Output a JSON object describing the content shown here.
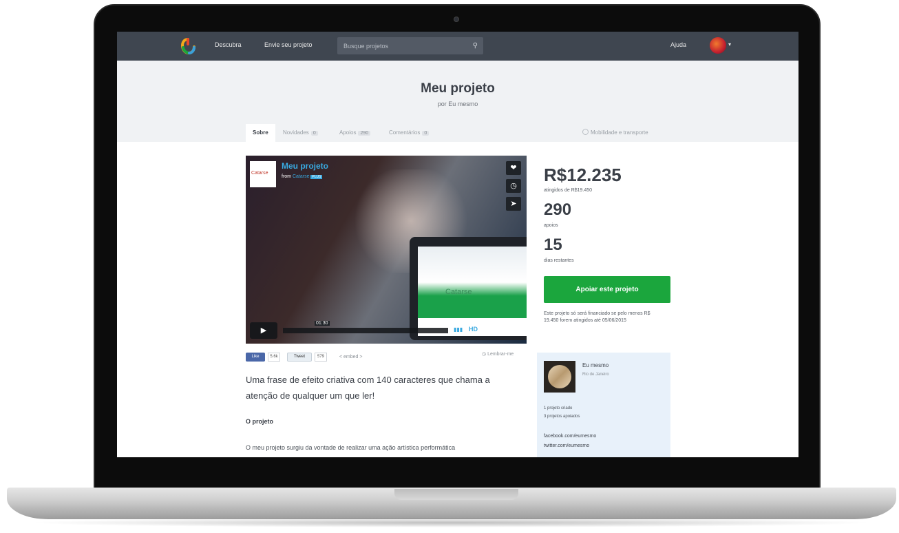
{
  "topbar": {
    "nav": [
      "Descubra",
      "Envie seu projeto"
    ],
    "search_placeholder": "Busque projetos",
    "help": "Ajuda"
  },
  "project": {
    "title": "Meu projeto",
    "byline": "por Eu mesmo",
    "category": "Mobilidade e transporte"
  },
  "tabs": [
    {
      "label": "Sobre",
      "count": ""
    },
    {
      "label": "Novidades",
      "count": "0"
    },
    {
      "label": "Apoios",
      "count": "290"
    },
    {
      "label": "Comentários",
      "count": "0"
    }
  ],
  "video": {
    "thumb_label": "Catarse",
    "title": "Meu projeto",
    "from_prefix": "from",
    "from_name": "Catarse",
    "from_badge": "PLUS",
    "time": "01:30",
    "screen_label": "Catarse",
    "hd": "HD",
    "vimeo": "vimeo"
  },
  "social": {
    "like_label": "Like",
    "like_count": "5.6k",
    "tweet_label": "Tweet",
    "tweet_count": "579",
    "embed": "< embed >",
    "remind": "Lembrar-me"
  },
  "body": {
    "headline": "Uma frase de efeito criativa com 140 caracteres que chama a atenção de qualquer um que ler!",
    "section_title": "O projeto",
    "paragraph": "O meu projeto surgiu da vontade de realizar uma ação artística performática"
  },
  "stats": {
    "pledged": "R$12.235",
    "goal_text": "atingidos de R$19.450",
    "backers": "290",
    "backers_label": "apoios",
    "days": "15",
    "days_label": "dias restantes"
  },
  "cta": {
    "back_label": "Apoiar este projeto",
    "note": "Este projeto só será financiado se pelo menos R$ 19.450 forem atingidos até 05/06/2015"
  },
  "creator": {
    "name": "Eu mesmo",
    "location": "Rio de Janeiro",
    "created": "1 projeto criado",
    "supported": "3 projetos apoiados",
    "links": [
      "facebook.com/eumesmo",
      "twitter.com/eumesmo"
    ]
  },
  "colors": {
    "topbar": "#3f4650",
    "header_bg": "#f0f2f4",
    "cta_green": "#1ba63d",
    "creator_bg": "#e8f1fa",
    "link_blue": "#39a9e0"
  }
}
